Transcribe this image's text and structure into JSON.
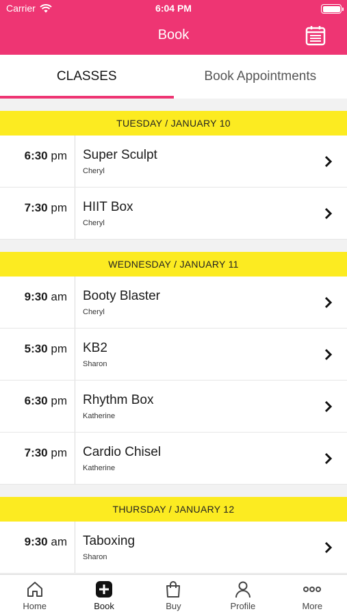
{
  "status": {
    "carrier": "Carrier",
    "time": "6:04 PM"
  },
  "header": {
    "title": "Book",
    "calendar_icon": "calendar-icon",
    "color": "#ee3573"
  },
  "tabs": [
    {
      "label": "CLASSES",
      "active": true
    },
    {
      "label": "Book Appointments",
      "active": false
    }
  ],
  "days": [
    {
      "label": "TUESDAY / JANUARY 10",
      "classes": [
        {
          "time": "6:30",
          "ampm": "pm",
          "name": "Super Sculpt",
          "instructor": "Cheryl"
        },
        {
          "time": "7:30",
          "ampm": "pm",
          "name": "HIIT Box",
          "instructor": "Cheryl"
        }
      ]
    },
    {
      "label": "WEDNESDAY / JANUARY 11",
      "classes": [
        {
          "time": "9:30",
          "ampm": "am",
          "name": "Booty Blaster",
          "instructor": "Cheryl"
        },
        {
          "time": "5:30",
          "ampm": "pm",
          "name": "KB2",
          "instructor": "Sharon"
        },
        {
          "time": "6:30",
          "ampm": "pm",
          "name": "Rhythm Box",
          "instructor": "Katherine"
        },
        {
          "time": "7:30",
          "ampm": "pm",
          "name": "Cardio Chisel",
          "instructor": "Katherine"
        }
      ]
    },
    {
      "label": "THURSDAY / JANUARY 12",
      "classes": [
        {
          "time": "9:30",
          "ampm": "am",
          "name": "Taboxing",
          "instructor": "Sharon"
        }
      ]
    }
  ],
  "tabbar": [
    {
      "label": "Home",
      "icon": "home-icon"
    },
    {
      "label": "Book",
      "icon": "plus-square-icon",
      "active": true
    },
    {
      "label": "Buy",
      "icon": "shopping-bag-icon"
    },
    {
      "label": "Profile",
      "icon": "person-icon"
    },
    {
      "label": "More",
      "icon": "more-dots-icon"
    }
  ],
  "colors": {
    "accent": "#ee3573",
    "day_header": "#fceb21"
  }
}
